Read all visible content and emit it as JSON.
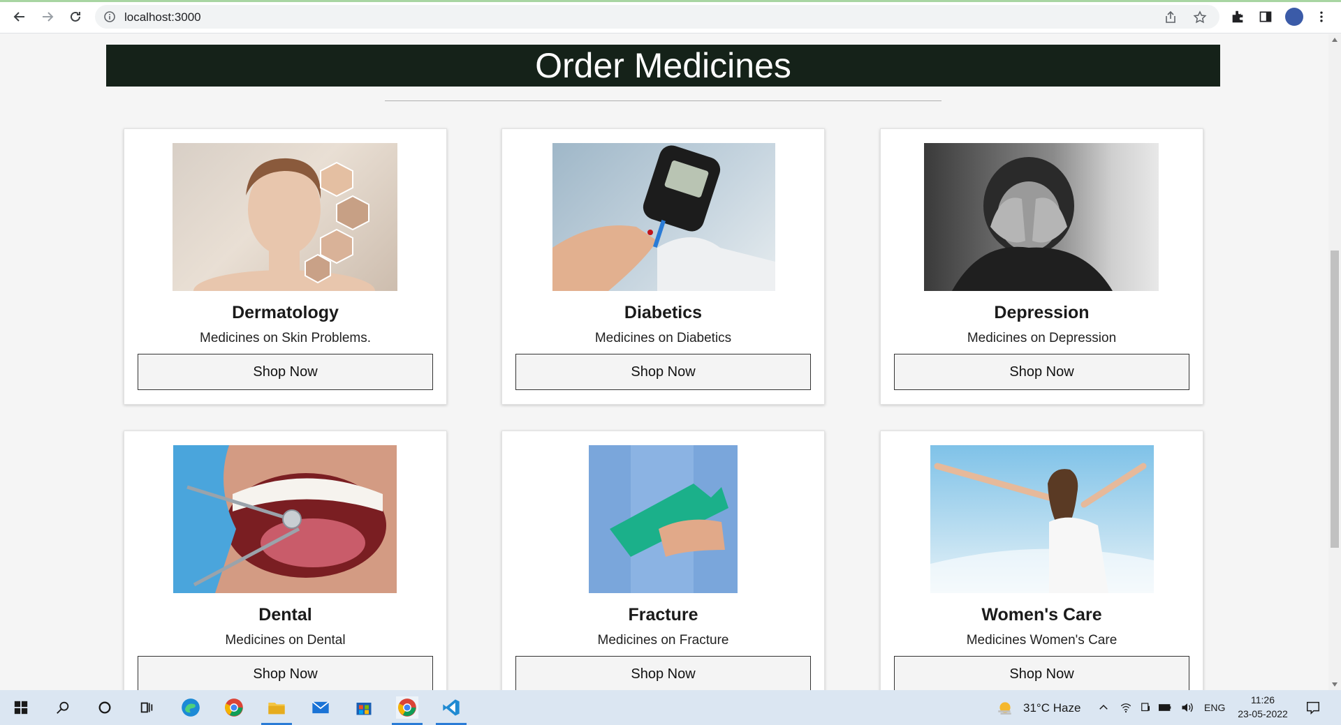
{
  "browser": {
    "url": "localhost:3000"
  },
  "page": {
    "heading": "Order Medicines",
    "cards": [
      {
        "title": "Dermatology",
        "desc": "Medicines on Skin Problems.",
        "button": "Shop Now"
      },
      {
        "title": "Diabetics",
        "desc": "Medicines on Diabetics",
        "button": "Shop Now"
      },
      {
        "title": "Depression",
        "desc": "Medicines on Depression",
        "button": "Shop Now"
      },
      {
        "title": "Dental",
        "desc": "Medicines on Dental",
        "button": "Shop Now"
      },
      {
        "title": "Fracture",
        "desc": "Medicines on Fracture",
        "button": "Shop Now"
      },
      {
        "title": "Women's Care",
        "desc": "Medicines Women's Care",
        "button": "Shop Now"
      }
    ]
  },
  "taskbar": {
    "weather": "31°C  Haze",
    "language": "ENG",
    "time": "11:26",
    "date": "23-05-2022"
  },
  "colors": {
    "banner": "#152219",
    "taskbar": "#dbe6f2"
  }
}
